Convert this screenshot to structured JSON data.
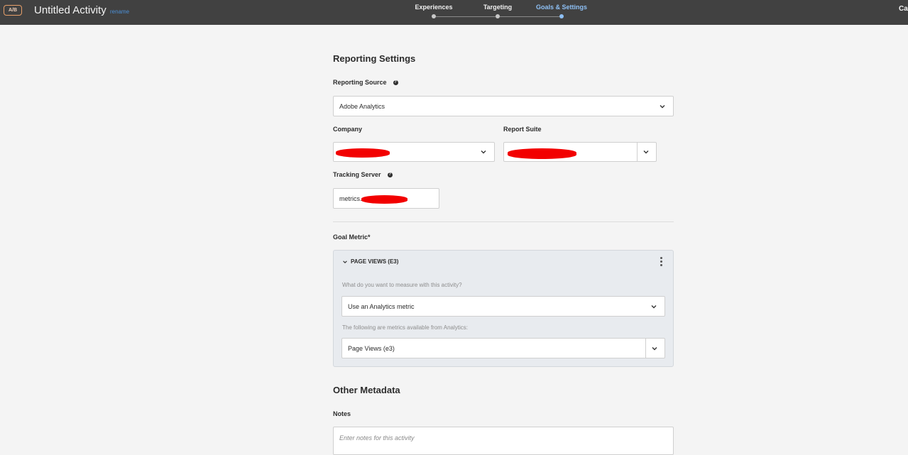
{
  "header": {
    "badge": "A/B",
    "title": "Untitled Activity",
    "rename": "rename",
    "steps": [
      {
        "label": "Experiences"
      },
      {
        "label": "Targeting"
      },
      {
        "label": "Goals & Settings",
        "active": true
      }
    ],
    "right_cut": "Ca"
  },
  "reporting": {
    "heading": "Reporting Settings",
    "source_label": "Reporting Source",
    "source_value": "Adobe Analytics",
    "company_label": "Company",
    "report_suite_label": "Report Suite",
    "tracking_label": "Tracking Server",
    "tracking_value_prefix": "metrics."
  },
  "goal": {
    "label": "Goal Metric*",
    "metric_title": "PAGE VIEWS (E3)",
    "question": "What do you want to measure with this activity?",
    "measure_value": "Use an Analytics metric",
    "available_label": "The following are metrics available from Analytics:",
    "metric_value": "Page Views (e3)"
  },
  "metadata": {
    "heading": "Other Metadata",
    "notes_label": "Notes",
    "notes_placeholder": "Enter notes for this activity"
  },
  "colors": {
    "topbar": "#414141",
    "active_step": "#8ec0f5",
    "redaction": "#f20000"
  }
}
